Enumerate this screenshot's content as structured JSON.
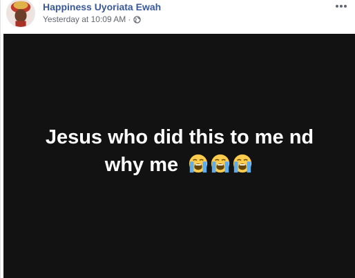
{
  "post": {
    "author": "Happiness Uyoriata Ewah",
    "timestamp": "Yesterday at 10:09 AM",
    "separator": "·",
    "privacy_icon": "globe-icon",
    "more_icon": "more-horizontal-icon",
    "text": "Jesus who did this to me nd why me",
    "emojis": [
      "loudly-crying-face-icon",
      "loudly-crying-face-icon",
      "loudly-crying-face-icon"
    ]
  },
  "colors": {
    "author_link": "#385898",
    "meta_text": "#616770",
    "media_background": "#121212",
    "post_text": "#ffffff"
  }
}
